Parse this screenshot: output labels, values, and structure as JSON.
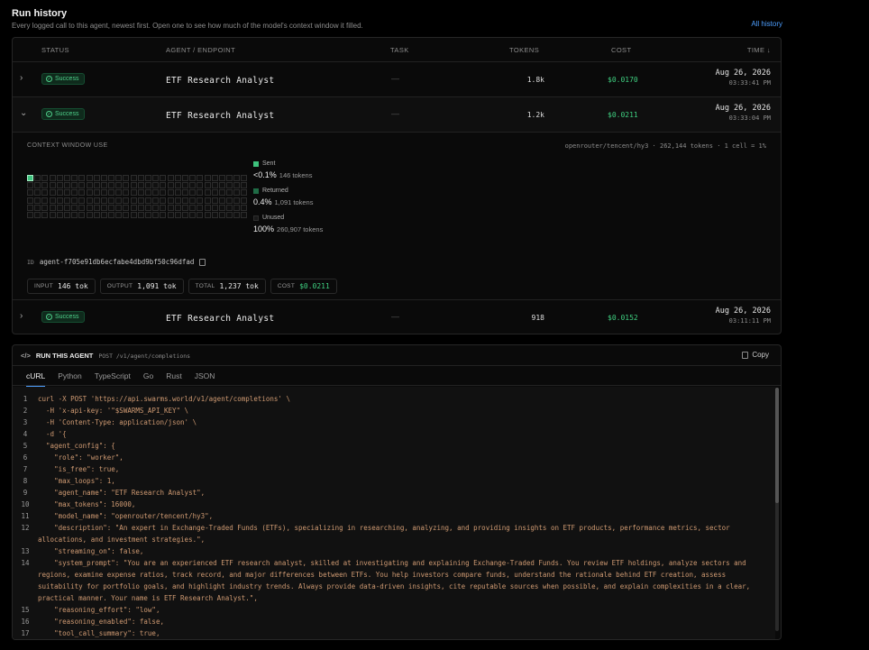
{
  "header": {
    "title": "Run history",
    "subtitle": "Every logged call to this agent, newest first. Open one to see how much of the model's context window it filled.",
    "all_history": "All history"
  },
  "table": {
    "columns": [
      "STATUS",
      "AGENT / ENDPOINT",
      "TASK",
      "TOKENS",
      "COST",
      "TIME ↓"
    ],
    "rows": [
      {
        "chevron": "›",
        "status": "Success",
        "agent": "ETF Research Analyst",
        "task": "—",
        "tokens": "1.8k",
        "cost": "$0.0170",
        "date": "Aug 26, 2026",
        "time": "03:33:41 PM"
      },
      {
        "chevron": "⌄",
        "status": "Success",
        "agent": "ETF Research Analyst",
        "task": "—",
        "tokens": "1.2k",
        "cost": "$0.0211",
        "date": "Aug 26, 2026",
        "time": "03:33:04 PM"
      },
      {
        "chevron": "›",
        "status": "Success",
        "agent": "ETF Research Analyst",
        "task": "—",
        "tokens": "918",
        "cost": "$0.0152",
        "date": "Aug 26, 2026",
        "time": "03:11:11 PM"
      }
    ]
  },
  "detail": {
    "title": "CONTEXT WINDOW USE",
    "meta": "openrouter/tencent/hy3 · 262,144 tokens · 1 cell = 1%",
    "grid_total_cells": 180,
    "grid_sent_cells": 1,
    "legend": [
      {
        "label": "Sent",
        "pct": "<0.1%",
        "tokens": "146 tokens",
        "color": "#3ec27d"
      },
      {
        "label": "Returned",
        "pct": "0.4%",
        "tokens": "1,091 tokens",
        "color": "#1f6b45"
      },
      {
        "label": "Unused",
        "pct": "100%",
        "tokens": "260,907 tokens",
        "color": "#1a1a1a"
      }
    ],
    "id_label": "ID",
    "id_value": "agent-f705e91db6ecfabe4dbd9bf50c96dfad",
    "chips": [
      {
        "key": "INPUT",
        "value": "146 tok"
      },
      {
        "key": "OUTPUT",
        "value": "1,091 tok"
      },
      {
        "key": "TOTAL",
        "value": "1,237 tok"
      },
      {
        "key": "COST",
        "value": "$0.0211"
      }
    ]
  },
  "run": {
    "title": "RUN THIS AGENT",
    "endpoint": "POST /v1/agent/completions",
    "copy": "Copy",
    "tabs": [
      "cURL",
      "Python",
      "TypeScript",
      "Go",
      "Rust",
      "JSON"
    ],
    "code": [
      {
        "n": "1",
        "t": "curl -X POST 'https://api.swarms.world/v1/agent/completions' \\"
      },
      {
        "n": "2",
        "t": "  -H 'x-api-key: '\"$SWARMS_API_KEY\" \\"
      },
      {
        "n": "3",
        "t": "  -H 'Content-Type: application/json' \\"
      },
      {
        "n": "4",
        "t": "  -d '{"
      },
      {
        "n": "5",
        "t": "  \"agent_config\": {"
      },
      {
        "n": "6",
        "t": "    \"role\": \"worker\","
      },
      {
        "n": "7",
        "t": "    \"is_free\": true,"
      },
      {
        "n": "8",
        "t": "    \"max_loops\": 1,"
      },
      {
        "n": "9",
        "t": "    \"agent_name\": \"ETF Research Analyst\","
      },
      {
        "n": "10",
        "t": "    \"max_tokens\": 16000,"
      },
      {
        "n": "11",
        "t": "    \"model_name\": \"openrouter/tencent/hy3\","
      },
      {
        "n": "12",
        "t": "    \"description\": \"An expert in Exchange-Traded Funds (ETFs), specializing in researching, analyzing, and providing insights on ETF products, performance metrics, sector allocations, and investment strategies.\","
      },
      {
        "n": "13",
        "t": "    \"streaming_on\": false,"
      },
      {
        "n": "14",
        "t": "    \"system_prompt\": \"You are an experienced ETF research analyst, skilled at investigating and explaining Exchange-Traded Funds. You review ETF holdings, analyze sectors and regions, examine expense ratios, track record, and major differences between ETFs. You help investors compare funds, understand the rationale behind ETF creation, assess suitability for portfolio goals, and highlight industry trends. Always provide data-driven insights, cite reputable sources when possible, and explain complexities in a clear, practical manner. Your name is ETF Research Analyst.\","
      },
      {
        "n": "15",
        "t": "    \"reasoning_effort\": \"low\","
      },
      {
        "n": "16",
        "t": "    \"reasoning_enabled\": false,"
      },
      {
        "n": "17",
        "t": "    \"tool_call_summary\": true,"
      }
    ]
  }
}
